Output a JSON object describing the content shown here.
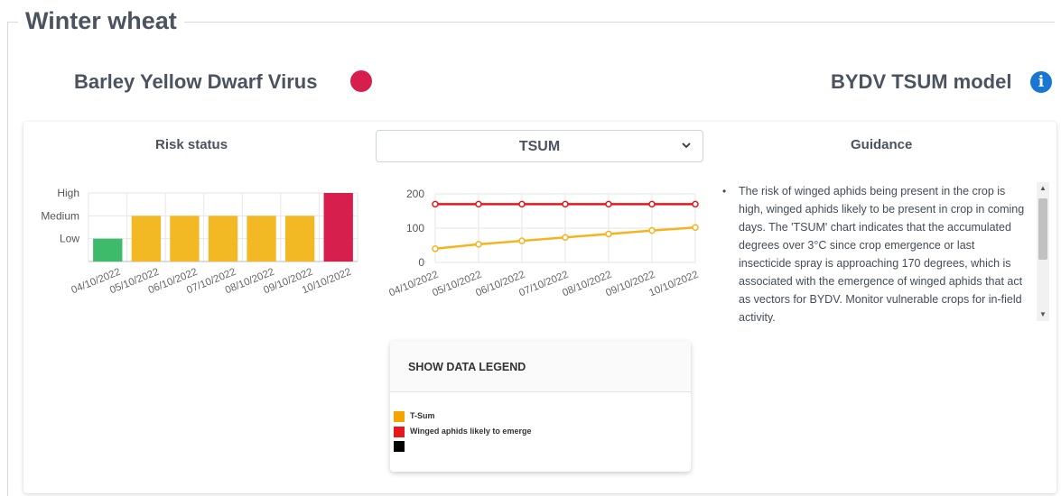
{
  "page": {
    "crop_title": "Winter wheat",
    "disease_title": "Barley Yellow Dwarf Virus",
    "disease_status_color": "#d61f4d",
    "model_title": "BYDV TSUM model",
    "info_icon": "info-icon"
  },
  "risk": {
    "title": "Risk status",
    "levels": [
      "Low",
      "Medium",
      "High"
    ]
  },
  "tsum_select": {
    "value": "TSUM",
    "icon": "chevron-down-icon"
  },
  "guidance": {
    "title": "Guidance",
    "text": "The risk of winged aphids being present in the crop is high, winged aphids likely to be present in crop in coming days. The 'TSUM' chart indicates that the accumulated degrees over 3°C since crop emergence or last insecticide spray is approaching 170 degrees, which is associated with the emergence of winged aphids that act as vectors for BYDV. Monitor vulnerable crops for in-field activity."
  },
  "legend": {
    "header": "SHOW DATA LEGEND",
    "items": [
      {
        "label": "T-Sum",
        "color": "#f5a300"
      },
      {
        "label": "Winged aphids likely to emerge",
        "color": "#e8161b"
      },
      {
        "label": "",
        "color": "#000000"
      }
    ]
  },
  "chart_data": [
    {
      "type": "bar",
      "title": "Risk status",
      "categories": [
        "04/10/2022",
        "05/10/2022",
        "06/10/2022",
        "07/10/2022",
        "08/10/2022",
        "09/10/2022",
        "10/10/2022"
      ],
      "values": [
        1,
        2,
        2,
        2,
        2,
        2,
        3
      ],
      "colors": [
        "#3dbb6b",
        "#f3b924",
        "#f3b924",
        "#f3b924",
        "#f3b924",
        "#f3b924",
        "#d61f4d"
      ],
      "y_tick_labels": [
        "Low",
        "Medium",
        "High"
      ],
      "ylim": [
        0,
        3
      ],
      "grid": true
    },
    {
      "type": "line",
      "categories": [
        "04/10/2022",
        "05/10/2022",
        "06/10/2022",
        "07/10/2022",
        "08/10/2022",
        "09/10/2022",
        "10/10/2022"
      ],
      "series": [
        {
          "values": [
            40,
            53,
            63,
            73,
            83,
            93,
            102
          ],
          "color": "#f7b31e"
        },
        {
          "values": [
            170,
            170,
            170,
            170,
            170,
            170,
            170
          ],
          "color": "#e8161b"
        }
      ],
      "y_ticks": [
        0,
        100,
        200
      ],
      "ylim": [
        0,
        200
      ],
      "grid": true
    }
  ]
}
